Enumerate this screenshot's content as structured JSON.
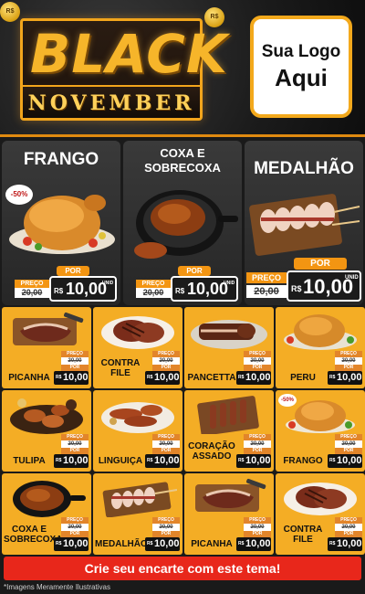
{
  "header": {
    "title_top": "BLACK",
    "title_bottom": "NOVEMBER",
    "coin_label": "R$",
    "logo_line1": "Sua Logo",
    "logo_line2": "Aqui"
  },
  "featured": [
    {
      "name": "FRANGO",
      "discount": "-50%",
      "preco_label": "PREÇO",
      "old_price": "20,00",
      "por_label": "POR",
      "currency": "R$",
      "price": "10,00",
      "unit": "UNID"
    },
    {
      "name_line1": "COXA E",
      "name_line2": "SOBRECOXA",
      "preco_label": "PREÇO",
      "old_price": "20,00",
      "por_label": "POR",
      "currency": "R$",
      "price": "10,00",
      "unit": "UNID"
    },
    {
      "name": "MEDALHÃO",
      "preco_label": "PREÇO",
      "old_price": "20,00",
      "por_label": "POR",
      "currency": "R$",
      "price": "10,00",
      "unit": "UNID"
    }
  ],
  "grid": [
    {
      "name": "PICANHA",
      "preco_label": "PREÇO",
      "old_price": "20,00",
      "por_label": "POR",
      "currency": "R$",
      "price": "10,00",
      "image": "picanha"
    },
    {
      "name_line1": "CONTRA",
      "name_line2": "FILE",
      "preco_label": "PREÇO",
      "old_price": "20,00",
      "por_label": "POR",
      "currency": "R$",
      "price": "10,00",
      "image": "steak"
    },
    {
      "name": "PANCETTA",
      "preco_label": "PREÇO",
      "old_price": "20,00",
      "por_label": "POR",
      "currency": "R$",
      "price": "10,00",
      "image": "pancetta"
    },
    {
      "name": "PERU",
      "preco_label": "PREÇO",
      "old_price": "20,00",
      "por_label": "POR",
      "currency": "R$",
      "price": "10,00",
      "image": "turkey"
    },
    {
      "name": "TULIPA",
      "preco_label": "PREÇO",
      "old_price": "20,00",
      "por_label": "POR",
      "currency": "R$",
      "price": "10,00",
      "image": "tulipa"
    },
    {
      "name": "LINGUIÇA",
      "preco_label": "PREÇO",
      "old_price": "20,00",
      "por_label": "POR",
      "currency": "R$",
      "price": "10,00",
      "image": "sausage"
    },
    {
      "name_line1": "CORAÇÃO",
      "name_line2": "ASSADO",
      "preco_label": "PREÇO",
      "old_price": "20,00",
      "por_label": "POR",
      "currency": "R$",
      "price": "10,00",
      "image": "skewers"
    },
    {
      "name": "FRANGO",
      "discount": "-50%",
      "preco_label": "PREÇO",
      "old_price": "20,00",
      "por_label": "POR",
      "currency": "R$",
      "price": "10,00",
      "image": "chicken"
    },
    {
      "name_line1": "COXA E",
      "name_line2": "SOBRECOXA",
      "preco_label": "PREÇO",
      "old_price": "20,00",
      "por_label": "POR",
      "currency": "R$",
      "price": "10,00",
      "image": "pan"
    },
    {
      "name": "MEDALHÃO",
      "preco_label": "PREÇO",
      "old_price": "20,00",
      "por_label": "POR",
      "currency": "R$",
      "price": "10,00",
      "image": "medalhao"
    },
    {
      "name": "PICANHA",
      "preco_label": "PREÇO",
      "old_price": "20,00",
      "por_label": "POR",
      "currency": "R$",
      "price": "10,00",
      "image": "picanha"
    },
    {
      "name_line1": "CONTRA",
      "name_line2": "FILE",
      "preco_label": "PREÇO",
      "old_price": "20,00",
      "por_label": "POR",
      "currency": "R$",
      "price": "10,00",
      "image": "steak"
    }
  ],
  "footer": {
    "cta": "Crie seu encarte com este tema!",
    "disclaimer": "*Imagens Meramente Ilustrativas"
  },
  "colors": {
    "accent": "#f39512",
    "cell_bg": "#f4ad25",
    "cta_red": "#e8271b",
    "dark": "#1a1a1a"
  }
}
